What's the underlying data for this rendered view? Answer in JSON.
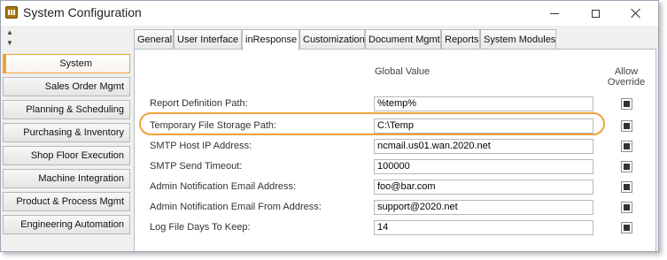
{
  "window": {
    "title": "System Configuration"
  },
  "sidebar": {
    "items": [
      {
        "label": "System",
        "active": true
      },
      {
        "label": "Sales Order Mgmt"
      },
      {
        "label": "Planning & Scheduling"
      },
      {
        "label": "Purchasing & Inventory"
      },
      {
        "label": "Shop Floor Execution"
      },
      {
        "label": "Machine Integration"
      },
      {
        "label": "Product & Process Mgmt"
      },
      {
        "label": "Engineering Automation"
      }
    ]
  },
  "tabs": [
    {
      "label": "General"
    },
    {
      "label": "User Interface"
    },
    {
      "label": "inResponse",
      "active": true
    },
    {
      "label": "Customization"
    },
    {
      "label": "Document Mgmt"
    },
    {
      "label": "Reports"
    },
    {
      "label": "System Modules"
    }
  ],
  "panel": {
    "global_value_header": "Global Value",
    "allow_override_header": "Allow Override",
    "rows": [
      {
        "label": "Report Definition Path:",
        "value": "%temp%",
        "override": true
      },
      {
        "label": "Temporary File Storage Path:",
        "value": "C:\\Temp",
        "override": true,
        "highlighted": true
      },
      {
        "label": "SMTP Host IP Address:",
        "value": "ncmail.us01.wan.2020.net",
        "override": true
      },
      {
        "label": "SMTP Send Timeout:",
        "value": "100000",
        "override": true
      },
      {
        "label": "Admin Notification Email Address:",
        "value": "foo@bar.com",
        "override": true
      },
      {
        "label": "Admin Notification Email From Address:",
        "value": "support@2020.net",
        "override": true
      },
      {
        "label": "Log File Days To Keep:",
        "value": "14",
        "override": true
      }
    ]
  },
  "colors": {
    "accent": "#f0a13a",
    "border": "#b6bcc6"
  }
}
